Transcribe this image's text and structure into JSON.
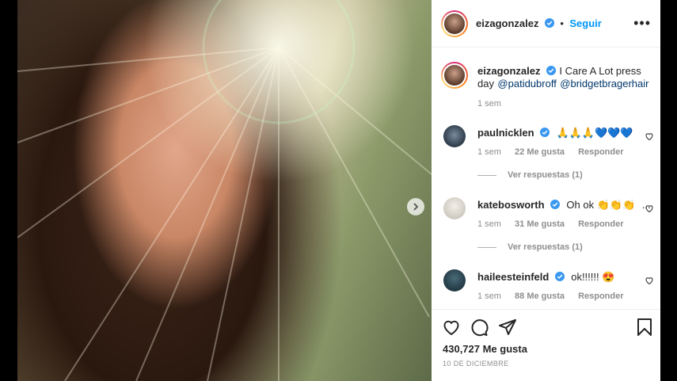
{
  "post": {
    "author": "eizagonzalez",
    "follow_label": "Seguir",
    "more_label": "•••",
    "caption_text": "I Care A Lot press day",
    "caption_mentions": [
      "@patidubroff",
      "@bridgetbragerhair"
    ],
    "caption_time": "1 sem",
    "likes": "430,727 Me gusta",
    "date": "10 DE DICIEMBRE"
  },
  "comments": [
    {
      "user": "paulnicklen",
      "text": "🙏🙏🙏💙💙💙",
      "time": "1 sem",
      "likes": "22 Me gusta",
      "reply": "Responder",
      "view_replies": "Ver respuestas (1)"
    },
    {
      "user": "katebosworth",
      "text": "Oh ok 👏👏👏",
      "ellipsis": "...",
      "time": "1 sem",
      "likes": "31 Me gusta",
      "reply": "Responder",
      "view_replies": "Ver respuestas (1)"
    },
    {
      "user": "haileesteinfeld",
      "text": "ok!!!!!! 😍",
      "time": "1 sem",
      "likes": "88 Me gusta",
      "reply": "Responder"
    }
  ],
  "colors": {
    "accent": "#0095f6",
    "verified": "#3897f0",
    "text": "#262626",
    "muted": "#8e8e8e"
  },
  "icons": [
    "heart-icon",
    "comment-icon",
    "share-icon",
    "bookmark-icon",
    "verified-icon",
    "chevron-right-icon",
    "more-icon"
  ]
}
